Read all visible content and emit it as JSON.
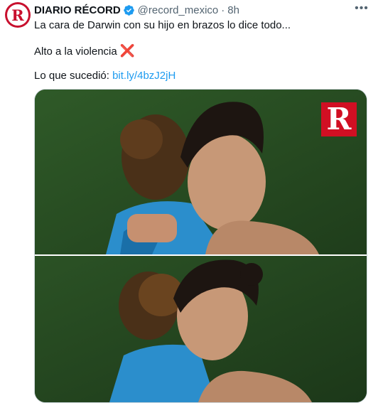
{
  "account": {
    "name": "DIARIO RÉCORD",
    "handle": "@record_mexico",
    "separator": "·",
    "time": "8h",
    "avatar_letter": "R",
    "brand_color": "#c8102e",
    "verified": true
  },
  "tweet": {
    "line1": "La cara de Darwin con su hijo en brazos lo dice todo...",
    "line2": "Alto a la violencia",
    "line2_emoji": "❌",
    "line3_prefix": "Lo que sucedió:",
    "link": "bit.ly/4bzJ2jH"
  },
  "media": {
    "watermark_letter": "R",
    "icons": [
      "more-options-icon",
      "verified-badge-icon"
    ]
  },
  "colors": {
    "link": "#1d9bf0",
    "secondary_text": "#536471",
    "verified": "#1d9bf0"
  }
}
